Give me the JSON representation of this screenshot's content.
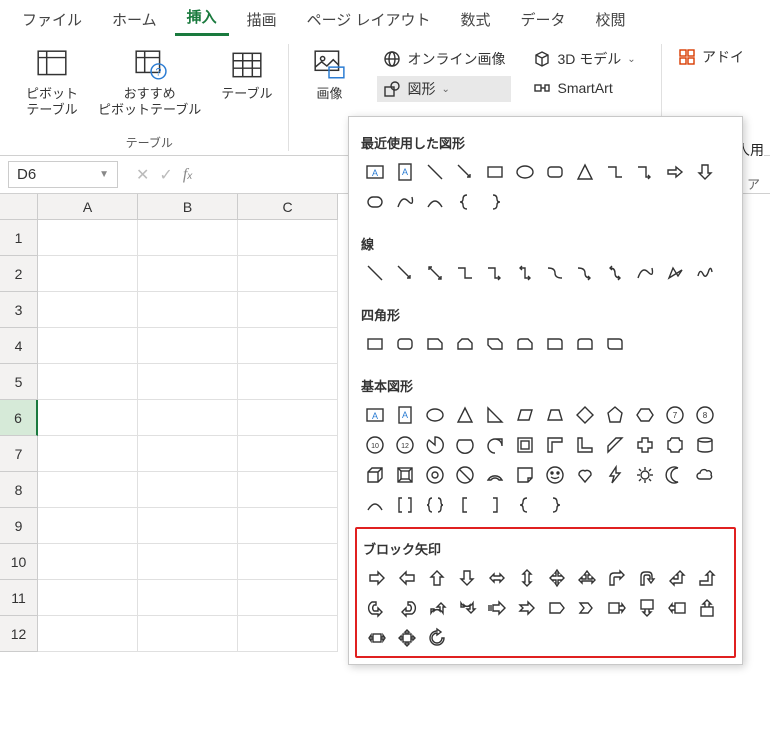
{
  "tabs": {
    "file": "ファイル",
    "home": "ホーム",
    "insert": "挿入",
    "draw": "描画",
    "page_layout": "ページ レイアウト",
    "formulas": "数式",
    "data": "データ",
    "review": "校閲"
  },
  "ribbon": {
    "pivot_table": "ピボット\nテーブル",
    "recommended_pivot": "おすすめ\nピボットテーブル",
    "table": "テーブル",
    "group_tables": "テーブル",
    "images": "画像",
    "online_images": "オンライン画像",
    "shapes": "図形",
    "smartart": "SmartArt",
    "threed_models": "3D モデル",
    "addins": "アドイ",
    "personal": "人用"
  },
  "formula_bar": {
    "name_box": "D6"
  },
  "columns": [
    "A",
    "B",
    "C"
  ],
  "rows": [
    "1",
    "2",
    "3",
    "4",
    "5",
    "6",
    "7",
    "8",
    "9",
    "10",
    "11",
    "12"
  ],
  "shapes_menu": {
    "recent": "最近使用した図形",
    "lines": "線",
    "rectangles": "四角形",
    "basic": "基本図形",
    "block_arrows": "ブロック矢印"
  },
  "truncated": {
    "a": "ア"
  }
}
